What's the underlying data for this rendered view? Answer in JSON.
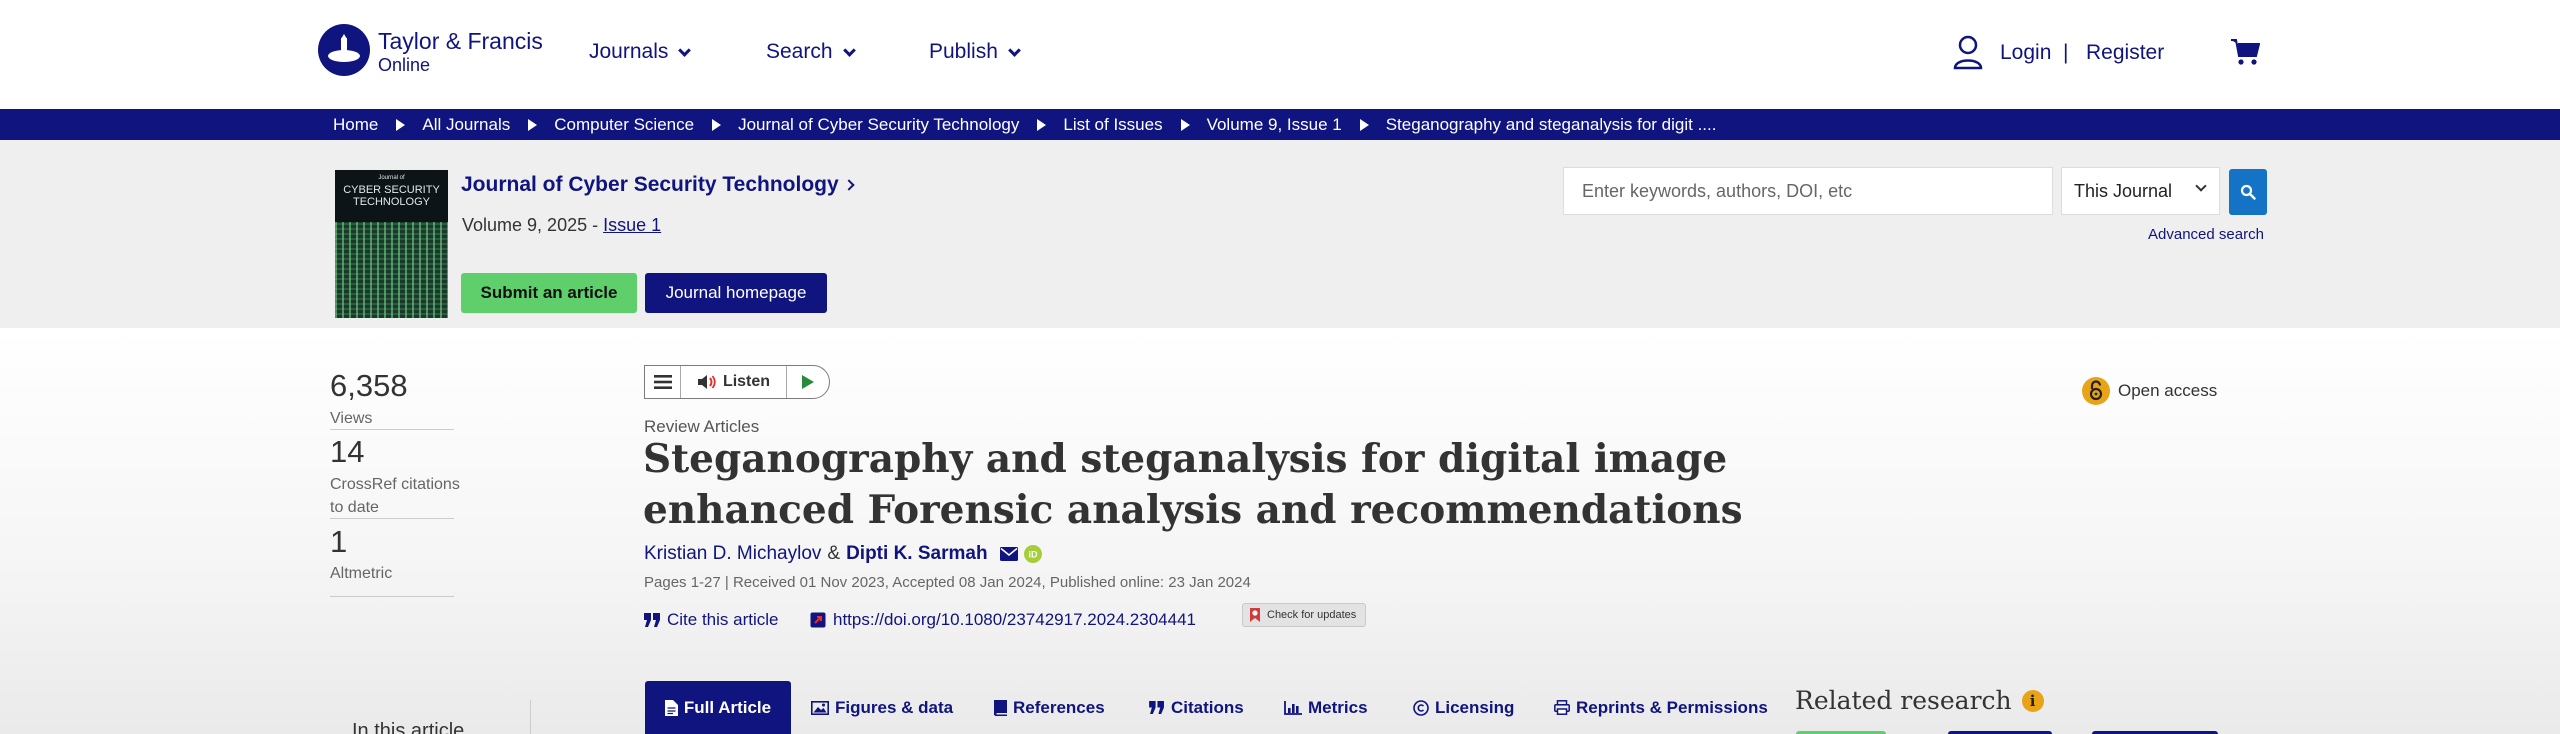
{
  "header": {
    "logo_line1": "Taylor & Francis",
    "logo_line2": "Online",
    "nav": [
      "Journals",
      "Search",
      "Publish"
    ],
    "login_label": "Login",
    "separator": "|",
    "register_label": "Register"
  },
  "breadcrumb": [
    "Home",
    "All Journals",
    "Computer Science",
    "Journal of Cyber Security Technology",
    "List of Issues",
    "Volume 9, Issue 1",
    "Steganography and steganalysis for digit ...."
  ],
  "journal": {
    "title": "Journal of Cyber Security Technology",
    "cover_small": "Journal of",
    "cover_title": "CYBER SECURITY TECHNOLOGY",
    "volume_text": "Volume 9, 2025 - ",
    "issue_link": "Issue 1",
    "submit_label": "Submit an article",
    "homepage_label": "Journal homepage"
  },
  "search": {
    "placeholder": "Enter keywords, authors, DOI, etc",
    "scope": "This Journal",
    "advanced_label": "Advanced search"
  },
  "metrics": [
    {
      "value": "6,358",
      "label": "Views"
    },
    {
      "value": "14",
      "label": "CrossRef citations to date"
    },
    {
      "value": "1",
      "label": "Altmetric"
    }
  ],
  "listen": {
    "label": "Listen"
  },
  "article": {
    "type": "Review Articles",
    "title": "Steganography and steganalysis for digital image enhanced Forensic analysis and recommendations",
    "author1": "Kristian D. Michaylov",
    "and": "&",
    "author2": "Dipti K. Sarmah",
    "pub_line": "Pages 1-27 | Received 01 Nov 2023, Accepted 08 Jan 2024, Published online: 23 Jan 2024",
    "cite_label": "Cite this article",
    "doi": "https://doi.org/10.1080/23742917.2024.2304441",
    "updates_label": "Check for updates",
    "open_access": "Open access"
  },
  "tabs": [
    "Full Article",
    "Figures & data",
    "References",
    "Citations",
    "Metrics",
    "Licensing",
    "Reprints & Permissions"
  ],
  "related": {
    "title": "Related research",
    "info": "i"
  },
  "sidebar": {
    "in_article": "In this article"
  },
  "colors": {
    "brand": "#10147e",
    "accent_green": "#5fcf6b",
    "search_blue": "#1573c6",
    "oa_orange": "#e8a317"
  }
}
